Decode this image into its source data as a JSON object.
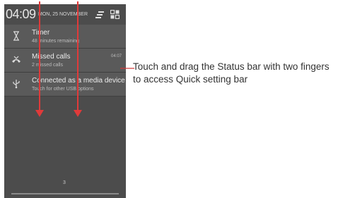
{
  "status_bar": {
    "time": "04:09",
    "date": "MON, 25 NOVEMBER"
  },
  "notifications": [
    {
      "icon": "hourglass-icon",
      "title": "Timer",
      "subtitle": "48 minutes remaining",
      "time": ""
    },
    {
      "icon": "missed-call-icon",
      "title": "Missed calls",
      "subtitle": "2 missed calls",
      "time": "04:07"
    },
    {
      "icon": "usb-icon",
      "title": "Connected as a media device",
      "subtitle": "Touch for other USB options",
      "time": ""
    }
  ],
  "page_indicator": "3",
  "annotation": {
    "line1": "Touch and drag the Status bar with two fingers",
    "line2": "to access Quick setting bar"
  },
  "colors": {
    "panel_bg": "#4c4c4c",
    "notification_bg": "#5a5a5a",
    "arrow": "#e03a3a",
    "callout_line": "#d23a3a"
  }
}
